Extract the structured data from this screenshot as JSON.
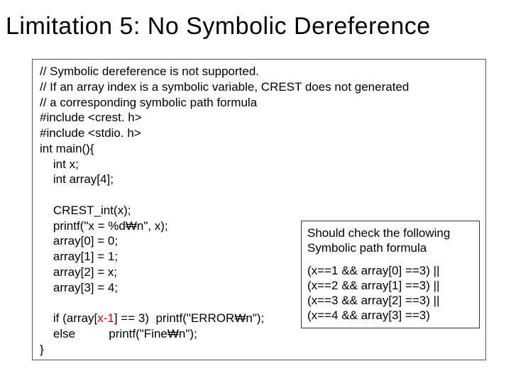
{
  "title": "Limitation 5: No Symbolic Dereference",
  "code": {
    "c1": "// Symbolic dereference is not supported.",
    "c2": "// If an array index is a symbolic variable, CREST does not generated",
    "c3": "// a corresponding symbolic path formula",
    "c4": "#include <crest. h>",
    "c5": "#include <stdio. h>",
    "c6": "int main(){",
    "c7": "    int x;",
    "c8": "    int array[4];",
    "c9": "",
    "c10": "    CREST_int(x);",
    "c11": "    printf(\"x = %d₩n\", x);",
    "c12": "    array[0] = 0;",
    "c13": "    array[1] = 1;",
    "c14": "    array[2] = x;",
    "c15": "    array[3] = 4;",
    "c16": "",
    "c17a": "    if (array[",
    "c17b": "x-1",
    "c17c": "] == 3)  printf(\"ERROR₩n\");",
    "c18": "    else          printf(\"Fine₩n\");",
    "c19": "}"
  },
  "anno": {
    "l1": "Should check the following",
    "l2": "Symbolic path formula",
    "f1": "(x==1 && array[0] ==3) ||",
    "f2": "(x==2 && array[1] ==3) ||",
    "f3": "(x==3 && array[2] ==3) ||",
    "f4": "(x==4 && array[3] ==3)"
  }
}
